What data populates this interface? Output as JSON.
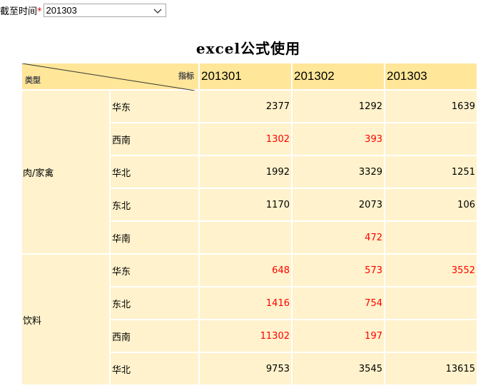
{
  "filter": {
    "label": "截至时间",
    "required_mark": "*",
    "value": "201303"
  },
  "title": "excel公式使用",
  "header": {
    "corner_type": "类型",
    "corner_metric": "指标",
    "periods": [
      "201301",
      "201302",
      "201303"
    ]
  },
  "groups": [
    {
      "type": "肉/家禽",
      "rows": [
        {
          "region": "华东",
          "values": [
            "2377",
            "1292",
            "1639"
          ],
          "red": [
            false,
            false,
            false
          ]
        },
        {
          "region": "西南",
          "values": [
            "1302",
            "393",
            ""
          ],
          "red": [
            true,
            true,
            false
          ]
        },
        {
          "region": "华北",
          "values": [
            "1992",
            "3329",
            "1251"
          ],
          "red": [
            false,
            false,
            false
          ]
        },
        {
          "region": "东北",
          "values": [
            "1170",
            "2073",
            "106"
          ],
          "red": [
            false,
            false,
            false
          ]
        },
        {
          "region": "华南",
          "values": [
            "",
            "472",
            ""
          ],
          "red": [
            false,
            true,
            false
          ]
        }
      ]
    },
    {
      "type": "饮料",
      "rows": [
        {
          "region": "华东",
          "values": [
            "648",
            "573",
            "3552"
          ],
          "red": [
            true,
            true,
            true
          ]
        },
        {
          "region": "东北",
          "values": [
            "1416",
            "754",
            ""
          ],
          "red": [
            true,
            true,
            false
          ]
        },
        {
          "region": "西南",
          "values": [
            "11302",
            "197",
            ""
          ],
          "red": [
            true,
            true,
            false
          ]
        },
        {
          "region": "华北",
          "values": [
            "9753",
            "3545",
            "13615"
          ],
          "red": [
            false,
            false,
            false
          ]
        }
      ]
    }
  ]
}
